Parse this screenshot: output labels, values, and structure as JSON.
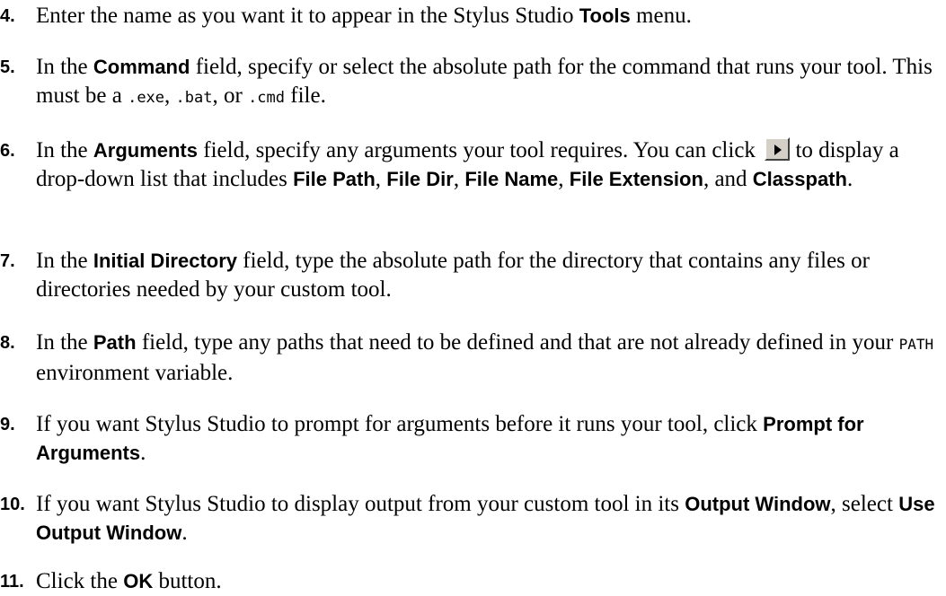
{
  "steps": [
    {
      "number": "4.",
      "parts": [
        {
          "t": "Enter the name as you want it to appear in the Stylus Studio "
        },
        {
          "b": "Tools"
        },
        {
          "t": " menu."
        }
      ]
    },
    {
      "number": "5.",
      "parts": [
        {
          "t": "In the "
        },
        {
          "b": "Command"
        },
        {
          "t": " field, specify or select the absolute path for the command that runs your tool. This must be a "
        },
        {
          "c": ".exe"
        },
        {
          "t": ", "
        },
        {
          "c": ".bat"
        },
        {
          "t": ", or "
        },
        {
          "c": ".cmd"
        },
        {
          "t": " file."
        }
      ]
    },
    {
      "number": "6.",
      "parts": [
        {
          "t": "In the "
        },
        {
          "b": "Arguments"
        },
        {
          "t": " field, specify any arguments your tool requires. You can click "
        },
        {
          "btn": "arrow-right"
        },
        {
          "t": " to display a drop-down list that includes "
        },
        {
          "b": "File Path"
        },
        {
          "t": ", "
        },
        {
          "b": "File Dir"
        },
        {
          "t": ", "
        },
        {
          "b": "File Name"
        },
        {
          "t": ", "
        },
        {
          "b": "File Extension"
        },
        {
          "t": ", and "
        },
        {
          "b": "Classpath"
        },
        {
          "t": "."
        }
      ]
    },
    {
      "number": "7.",
      "parts": [
        {
          "t": "In the "
        },
        {
          "b": "Initial Directory"
        },
        {
          "t": " field, type the absolute path for the directory that contains any files or directories needed by your custom tool."
        }
      ]
    },
    {
      "number": "8.",
      "parts": [
        {
          "t": "In the "
        },
        {
          "b": "Path"
        },
        {
          "t": " field, type any paths that need to be defined and that are not already defined in your "
        },
        {
          "s": "PATH"
        },
        {
          "t": " environment variable."
        }
      ]
    },
    {
      "number": "9.",
      "parts": [
        {
          "t": "If you want Stylus Studio to prompt for arguments before it runs your tool, click "
        },
        {
          "b": "Prompt for Arguments"
        },
        {
          "t": "."
        }
      ]
    },
    {
      "number": "10.",
      "parts": [
        {
          "t": "If you want Stylus Studio to display output from your custom tool in its "
        },
        {
          "b": "Output Window"
        },
        {
          "t": ", select "
        },
        {
          "b": "Use Output Window"
        },
        {
          "t": "."
        }
      ]
    },
    {
      "number": "11.",
      "parts": [
        {
          "t": "Click the "
        },
        {
          "b": "OK"
        },
        {
          "t": " button."
        }
      ]
    }
  ]
}
